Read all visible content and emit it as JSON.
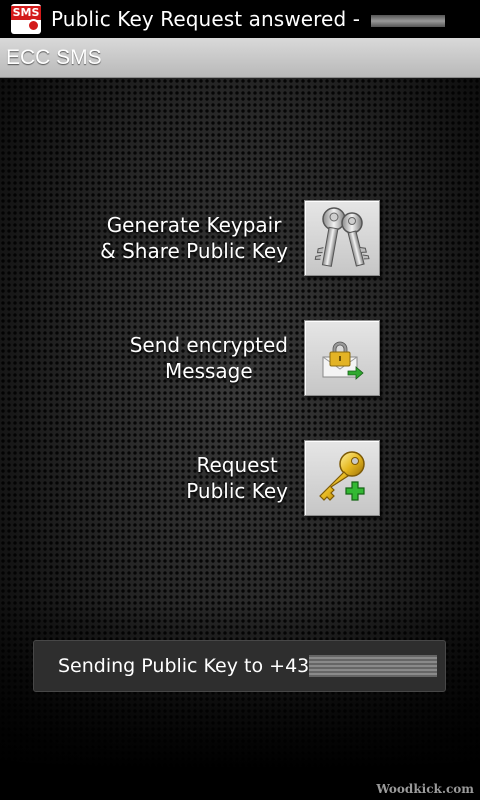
{
  "status_bar": {
    "notification_text": "Public Key Request answered - ",
    "icon": "sms-app-icon",
    "icon_label": "SMS"
  },
  "title_bar": {
    "title": "ECC SMS"
  },
  "actions": [
    {
      "label": "Generate Keypair\n& Share Public Key",
      "icon": "keys-icon"
    },
    {
      "label": "Send encrypted\nMessage",
      "icon": "encrypted-mail-icon"
    },
    {
      "label": "Request\nPublic Key",
      "icon": "add-key-icon"
    }
  ],
  "toast": {
    "message": "Sending Public Key to +43"
  },
  "watermark": "Woodkick.com",
  "colors": {
    "title_bar": "#c9c9c9",
    "button_face": "#d8d8d8",
    "toast_bg": "#2e2e2e"
  }
}
